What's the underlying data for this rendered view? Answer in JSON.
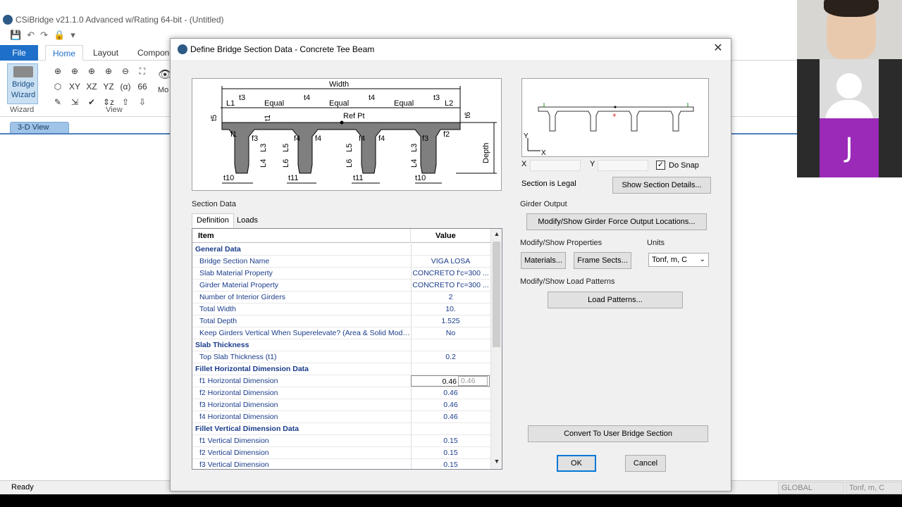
{
  "app": {
    "title": "CSiBridge v21.1.0 Advanced w/Rating 64-bit - (Untitled)",
    "ribbon_tabs": [
      "File",
      "Home",
      "Layout",
      "Compone"
    ],
    "bridge_wizard_label": "Bridge Wizard",
    "group_wizard": "Wizard",
    "group_view": "View",
    "more_label": "Mo",
    "ribbon_icons": [
      "⊕",
      "⊕",
      "⊕",
      "⊕",
      "⊖",
      "⛶",
      "⬡",
      "XY",
      "XZ",
      "YZ",
      "(α)",
      "66",
      "✎",
      "⇲",
      "✔",
      "⇕z",
      "⇧",
      "⇩"
    ],
    "view_tab": "3-D View",
    "status_ready": "Ready",
    "status_global": "GLOBAL",
    "status_units": "Tonf, m, C"
  },
  "dialog": {
    "title": "Define Bridge Section Data - Concrete Tee Beam",
    "figure": {
      "width_label": "Width",
      "ref_pt": "Ref Pt",
      "depth_label": "Depth",
      "top_labels": [
        "L1",
        "t3",
        "Equal",
        "t4",
        "Equal",
        "t4",
        "Equal",
        "t3",
        "L2"
      ],
      "side_labels": [
        "t5",
        "t1",
        "t6"
      ],
      "fillet_labels": [
        "f1",
        "f3",
        "f4",
        "f4",
        "f4",
        "f4",
        "f3",
        "f2"
      ],
      "length_labels": [
        "L3",
        "L5",
        "L5",
        "L3",
        "L4",
        "L6",
        "L6",
        "L4"
      ],
      "bottom_labels": [
        "t10",
        "t11",
        "t11",
        "t10"
      ]
    },
    "mini": {
      "axis_y": "Y",
      "axis_x": "X"
    },
    "coords": {
      "x_label": "X",
      "y_label": "Y",
      "x_value": "",
      "y_value": ""
    },
    "do_snap_label": "Do Snap",
    "do_snap_checked": true,
    "section_legal": "Section is Legal",
    "show_details_btn": "Show Section Details...",
    "section_data_label": "Section Data",
    "tabs": [
      "Definition",
      "Loads"
    ],
    "grid": {
      "col_item": "Item",
      "col_value": "Value",
      "rows": [
        {
          "item": "General Data",
          "value": "",
          "group": true
        },
        {
          "item": "Bridge Section Name",
          "value": "VIGA LOSA"
        },
        {
          "item": "Slab Material Property",
          "value": "CONCRETO f'c=300 ..."
        },
        {
          "item": "Girder Material Property",
          "value": "CONCRETO f'c=300 ..."
        },
        {
          "item": "Number of Interior Girders",
          "value": "2"
        },
        {
          "item": "Total Width",
          "value": "10."
        },
        {
          "item": "Total Depth",
          "value": "1.525"
        },
        {
          "item": "Keep Girders Vertical When Superelevate?  (Area & Solid Mode...",
          "value": "No"
        },
        {
          "item": "Slab Thickness",
          "value": "",
          "group": true
        },
        {
          "item": "Top Slab Thickness (t1)",
          "value": "0.2"
        },
        {
          "item": "Fillet Horizontal Dimension Data",
          "value": "",
          "group": true
        },
        {
          "item": "f1 Horizontal Dimension",
          "value": "0.46",
          "edit": true,
          "ghost": "0.46"
        },
        {
          "item": "f2 Horizontal Dimension",
          "value": "0.46"
        },
        {
          "item": "f3 Horizontal Dimension",
          "value": "0.46"
        },
        {
          "item": "f4 Horizontal Dimension",
          "value": "0.46"
        },
        {
          "item": "Fillet Vertical Dimension Data",
          "value": "",
          "group": true
        },
        {
          "item": "f1 Vertical Dimension",
          "value": "0.15"
        },
        {
          "item": "f2 Vertical Dimension",
          "value": "0.15"
        },
        {
          "item": "f3 Vertical Dimension",
          "value": "0.15"
        }
      ]
    },
    "girder_output_label": "Girder Output",
    "girder_output_btn": "Modify/Show Girder Force Output Locations...",
    "props_label": "Modify/Show Properties",
    "materials_btn": "Materials...",
    "frame_sects_btn": "Frame Sects...",
    "units_label": "Units",
    "units_value": "Tonf, m, C",
    "load_patterns_label": "Modify/Show Load Patterns",
    "load_patterns_btn": "Load Patterns...",
    "convert_btn": "Convert To User Bridge Section",
    "ok_btn": "OK",
    "cancel_btn": "Cancel"
  },
  "webcam": {
    "participant_initial": "J"
  },
  "colors": {
    "accent": "#1e6fc9",
    "grid_text": "#1a3c8a",
    "avatar_purple": "#9b2ab8"
  }
}
